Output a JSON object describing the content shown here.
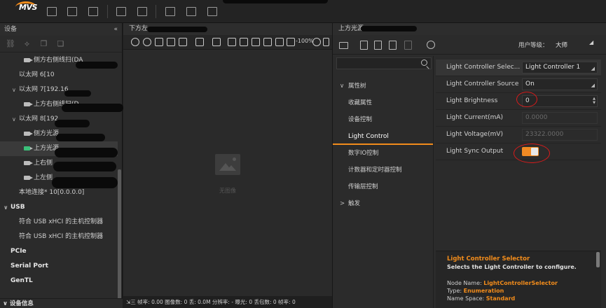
{
  "left_panel": {
    "title": "设备",
    "pin_icon": "«",
    "items": [
      {
        "label": "侧方右侧线扫(DA",
        "indent": 48,
        "icon": "camera",
        "selected": false
      },
      {
        "label": "以太网 6[10",
        "indent": 27,
        "icon": "none",
        "caret": "",
        "selected": false
      },
      {
        "label": "以太网 7[192.16",
        "indent": 27,
        "icon": "none",
        "caret": "∨",
        "selected": false
      },
      {
        "label": "上方右侧线扫(D",
        "indent": 48,
        "icon": "camera",
        "selected": false
      },
      {
        "label": "以太网 8[192",
        "indent": 27,
        "icon": "none",
        "caret": "∨",
        "selected": false
      },
      {
        "label": "侧方光源",
        "indent": 48,
        "icon": "camera",
        "selected": false
      },
      {
        "label": "上方光源",
        "indent": 48,
        "icon": "camera-green",
        "selected": true
      },
      {
        "label": "上右侧",
        "indent": 48,
        "icon": "camera",
        "selected": false
      },
      {
        "label": "上左侧",
        "indent": 48,
        "icon": "camera",
        "selected": false
      },
      {
        "label": "本地连接* 10[0.0.0.0]",
        "indent": 27,
        "icon": "none",
        "selected": false
      },
      {
        "label": "USB",
        "indent": 15,
        "icon": "none",
        "caret": "∨",
        "bold": true,
        "selected": false
      },
      {
        "label": "符合 USB xHCI 的主机控制器",
        "indent": 27,
        "icon": "none",
        "selected": false
      },
      {
        "label": "符合 USB xHCI 的主机控制器",
        "indent": 27,
        "icon": "none",
        "selected": false
      },
      {
        "label": "PCIe",
        "indent": 15,
        "icon": "none",
        "bold": true,
        "selected": false
      },
      {
        "label": "Serial Port",
        "indent": 15,
        "icon": "none",
        "bold": true,
        "selected": false
      },
      {
        "label": "GenTL",
        "indent": 15,
        "icon": "none",
        "bold": true,
        "selected": false
      }
    ],
    "bottom_label": "∨ 设备信息"
  },
  "image_panel": {
    "title": "下方左",
    "zoom": "-100%",
    "no_image_text": "无图像",
    "status_text": "⇲三 帧率: 0.00 图像数: 0 丢: 0.0M 分辨率: - 曝光: 0 丢包数: 0 帧率: 0"
  },
  "props_panel": {
    "title": "上方光源",
    "user_level_label": "用户等级：",
    "user_level_value": "大师",
    "categories": [
      {
        "label": "属性树",
        "type": "group",
        "caret": "∨"
      },
      {
        "label": "收藏属性",
        "type": "item"
      },
      {
        "label": "设备控制",
        "type": "item"
      },
      {
        "label": "Light Control",
        "type": "item",
        "active": true
      },
      {
        "label": "数字IO控制",
        "type": "item"
      },
      {
        "label": "计数器和定时器控制",
        "type": "item"
      },
      {
        "label": "传输层控制",
        "type": "item"
      },
      {
        "label": "触发",
        "type": "group",
        "caret": ">"
      }
    ],
    "properties": [
      {
        "name": "Light Controller Selec...",
        "value": "Light Controller 1",
        "kind": "dropdown",
        "head": true
      },
      {
        "name": "Light Controller Source",
        "value": "On",
        "kind": "dropdown"
      },
      {
        "name": "Light Brightness",
        "value": "0",
        "kind": "spin"
      },
      {
        "name": "Light Current(mA)",
        "value": "0.0000",
        "kind": "disabled"
      },
      {
        "name": "Light Voltage(mV)",
        "value": "23322.0000",
        "kind": "disabled"
      },
      {
        "name": "Light Sync Output",
        "value": "",
        "kind": "toggle",
        "toggle_on": true
      }
    ],
    "description": {
      "title": "Light Controller Selector",
      "text": "Selects the Light Controller to configure.",
      "node_name_label": "Node Name: ",
      "node_name_value": "LightControllerSelector",
      "type_label": "Type: ",
      "type_value": "Enumeration",
      "namespace_label": "Name Space: ",
      "namespace_value": "Standard"
    },
    "accent_color": "#f28c1b"
  }
}
